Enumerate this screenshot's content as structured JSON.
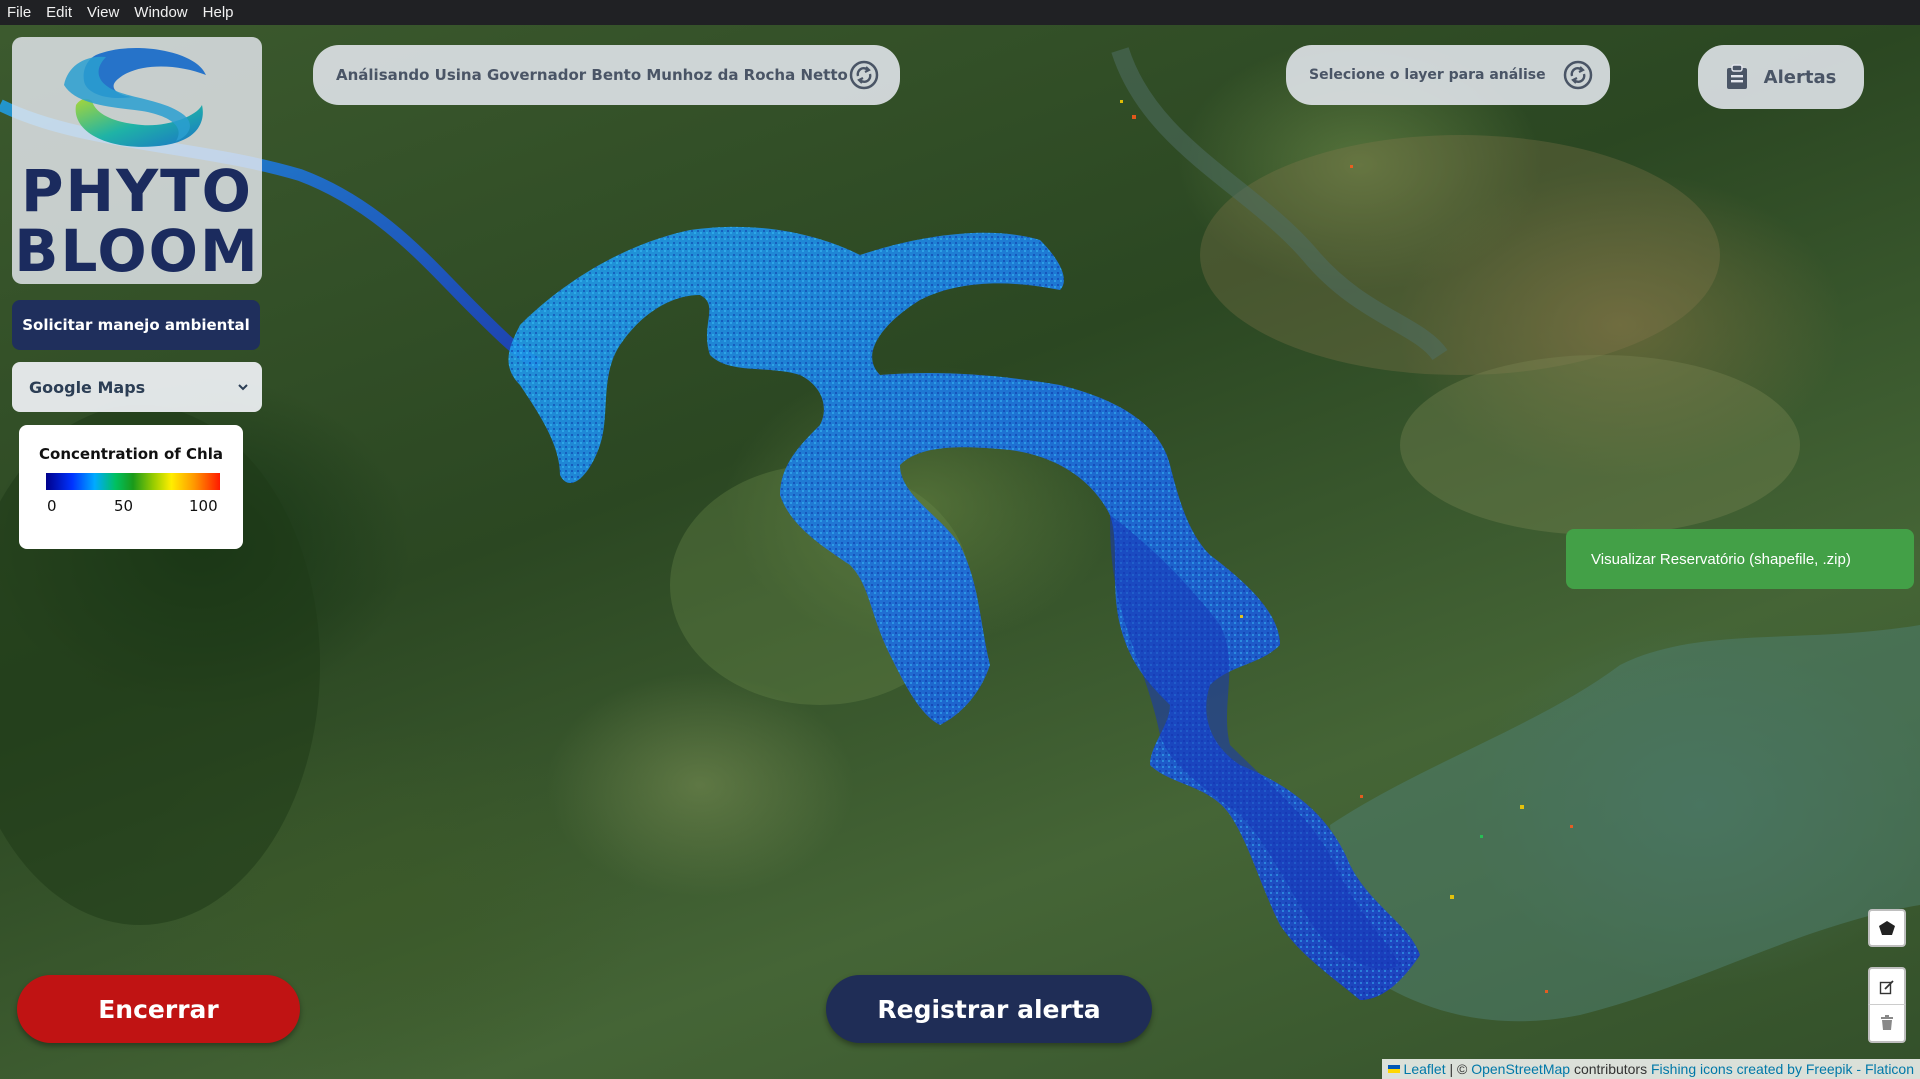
{
  "menu": [
    "File",
    "Edit",
    "View",
    "Window",
    "Help"
  ],
  "logo": {
    "line1": "PHYTO",
    "line2": "BLOOM"
  },
  "sidebar": {
    "manejo_label": "Solicitar manejo ambiental",
    "basemap_selected": "Google Maps"
  },
  "legend": {
    "title": "Concentration of Chla",
    "ticks": [
      "0",
      "50",
      "100"
    ],
    "colors": [
      "#00008b",
      "#0033ff",
      "#00aaff",
      "#1a9a1a",
      "#9acd00",
      "#ffee00",
      "#ff9900",
      "#ff1a00"
    ]
  },
  "header": {
    "analysis_label": "Análisando Usina Governador Bento Munhoz da Rocha Netto",
    "layer_label": "Selecione o layer para análise",
    "alerts_label": "Alertas"
  },
  "shapefile_label": "Visualizar Reservatório (shapefile, .zip)",
  "actions": {
    "encerrar": "Encerrar",
    "registrar": "Registrar alerta"
  },
  "attribution": {
    "leaflet": "Leaflet",
    "sep": "| ©",
    "osm": "OpenStreetMap",
    "contributors": "contributors",
    "icons": "Fishing icons created by Freepik - Flaticon"
  },
  "colors": {
    "brand_navy": "#1f2d56",
    "danger": "#c01313",
    "success": "#43a047",
    "water_chla_low": "#1a4fd6",
    "water_chla_mid": "#1fa0e8"
  },
  "icons": [
    "cycle-icon",
    "clipboard-icon",
    "chevron-down-icon",
    "polygon-icon",
    "edit-icon",
    "trash-icon"
  ]
}
